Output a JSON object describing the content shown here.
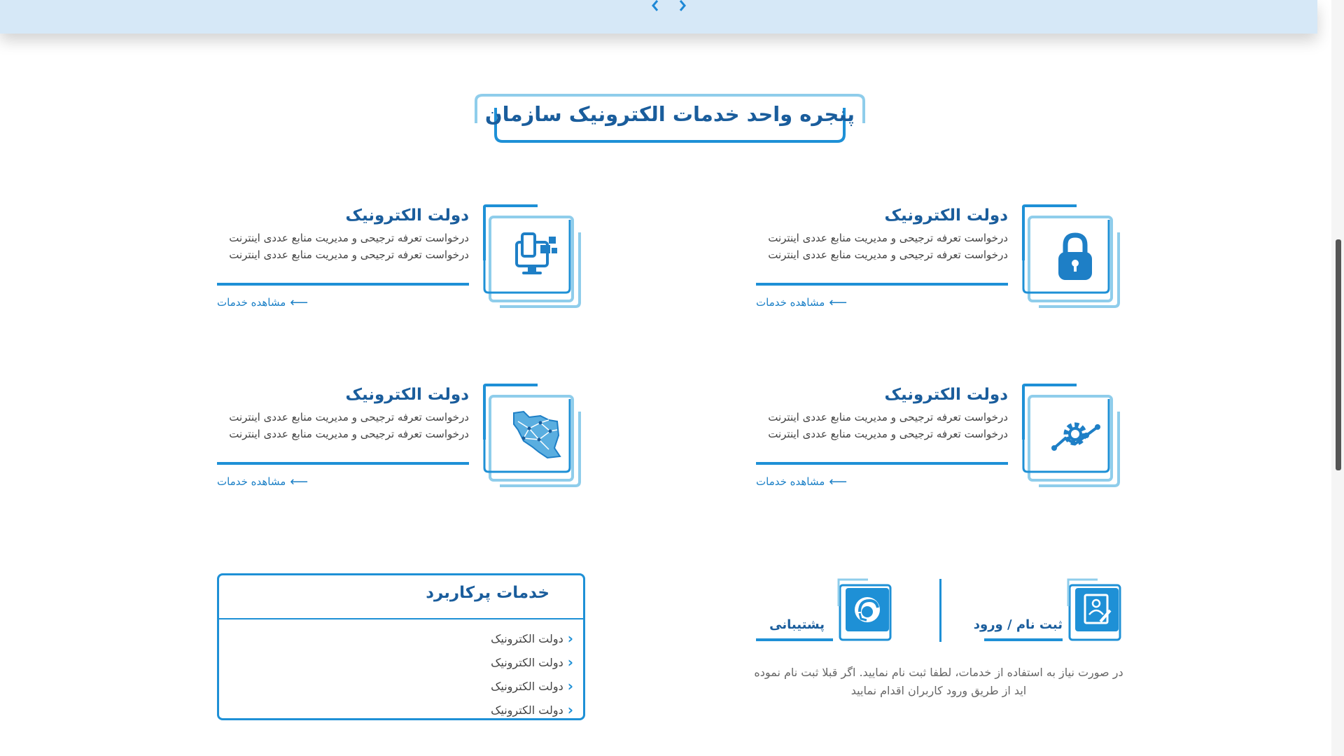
{
  "colors": {
    "accent": "#1e90d6",
    "title": "#1a5d9c",
    "banner": "#d6e8f7",
    "frame_light": "#8fcdeb"
  },
  "banner": {
    "prev_icon": "chevron-left-icon",
    "next_icon": "chevron-right-icon"
  },
  "section": {
    "title": "پنجره واحد خدمات الکترونیک سازمان"
  },
  "cards": [
    {
      "title": "دولت الکترونیک",
      "description": "درخواست تعرفه ترجیحی و مدیریت منابع عددی اینترنت درخواست تعرفه ترجیحی و مدیریت منابع عددی اینترنت",
      "link": "مشاهده خدمات",
      "icon": "lock-icon"
    },
    {
      "title": "دولت الکترونیک",
      "description": "درخواست تعرفه ترجیحی و مدیریت منابع عددی اینترنت درخواست تعرفه ترجیحی و مدیریت منابع عددی اینترنت",
      "link": "مشاهده خدمات",
      "icon": "devices-icon"
    },
    {
      "title": "دولت الکترونیک",
      "description": "درخواست تعرفه ترجیحی و مدیریت منابع عددی اینترنت درخواست تعرفه ترجیحی و مدیریت منابع عددی اینترنت",
      "link": "مشاهده خدمات",
      "icon": "gear-chart-icon"
    },
    {
      "title": "دولت الکترونیک",
      "description": "درخواست تعرفه ترجیحی و مدیریت منابع عددی اینترنت درخواست تعرفه ترجیحی و مدیریت منابع عددی اینترنت",
      "link": "مشاهده خدمات",
      "icon": "iran-map-icon"
    }
  ],
  "popular": {
    "title": "خدمات پرکاربرد",
    "items": [
      "دولت الکترونیک",
      "دولت الکترونیک",
      "دولت الکترونیک",
      "دولت الکترونیک"
    ]
  },
  "actions": {
    "register": {
      "label": "ثبت نام / ورود",
      "icon": "register-document-icon"
    },
    "support": {
      "label": "پشتیبانی",
      "icon": "support-headset-icon"
    },
    "info": "در صورت نیاز به استفاده از خدمات، لطفا ثبت نام نمایید. اگر قبلا ثبت نام نموده اید از طریق ورود کاربران اقدام نمایید"
  }
}
